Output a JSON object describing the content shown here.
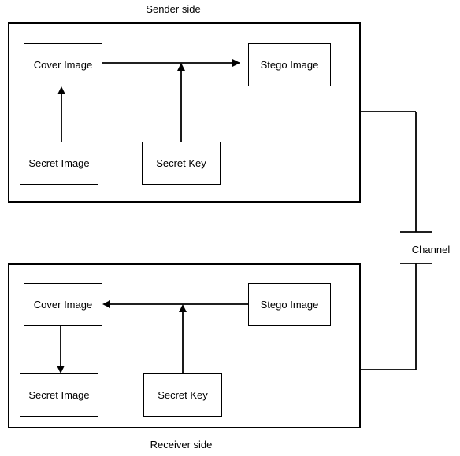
{
  "title_top": "Sender side",
  "title_bottom": "Receiver side",
  "channel_label": "Channel",
  "sender": {
    "cover_image": "Cover Image",
    "secret_image": "Secret Image",
    "secret_key": "Secret Key",
    "stego_image": "Stego Image"
  },
  "receiver": {
    "cover_image": "Cover Image",
    "secret_image": "Secret Image",
    "secret_key": "Secret Key",
    "stego_image": "Stego Image"
  }
}
